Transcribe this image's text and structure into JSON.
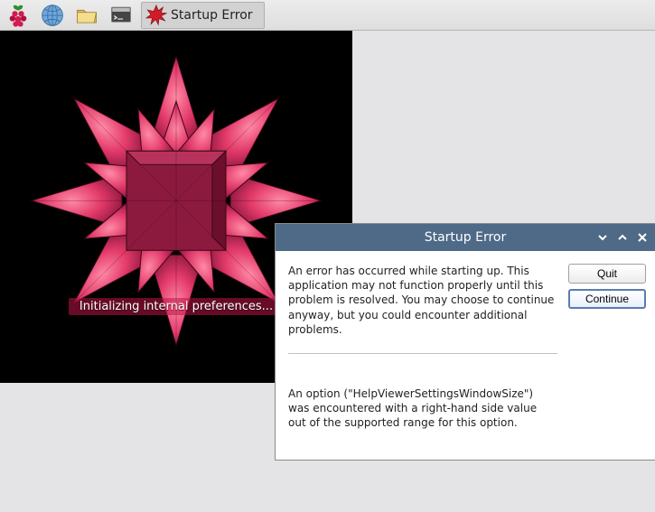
{
  "taskbar": {
    "app_title": "Startup Error"
  },
  "splash": {
    "status_text": "Initializing internal preferences..."
  },
  "dialog": {
    "title": "Startup Error",
    "body1": "An error has occurred while starting up. This application may not function properly until this problem is resolved. You may choose to continue anyway, but you could encounter additional problems.",
    "body2": "An option (\"HelpViewerSettingsWindowSize\") was encountered with a right-hand side value out of the supported range for this option.",
    "quit_label": "Quit",
    "continue_label": "Continue"
  },
  "icons": {
    "menu": "raspberry-menu-icon",
    "web": "globe-icon",
    "files": "file-manager-icon",
    "terminal": "terminal-icon",
    "error": "starburst-error-icon",
    "shade": "shade-icon",
    "maximize": "maximize-icon",
    "close": "close-icon"
  },
  "colors": {
    "titlebar": "#4e6a87",
    "accent": "#5a7cb0",
    "raspberry": "#d01c4f",
    "splash_star": "#e23a6a"
  }
}
